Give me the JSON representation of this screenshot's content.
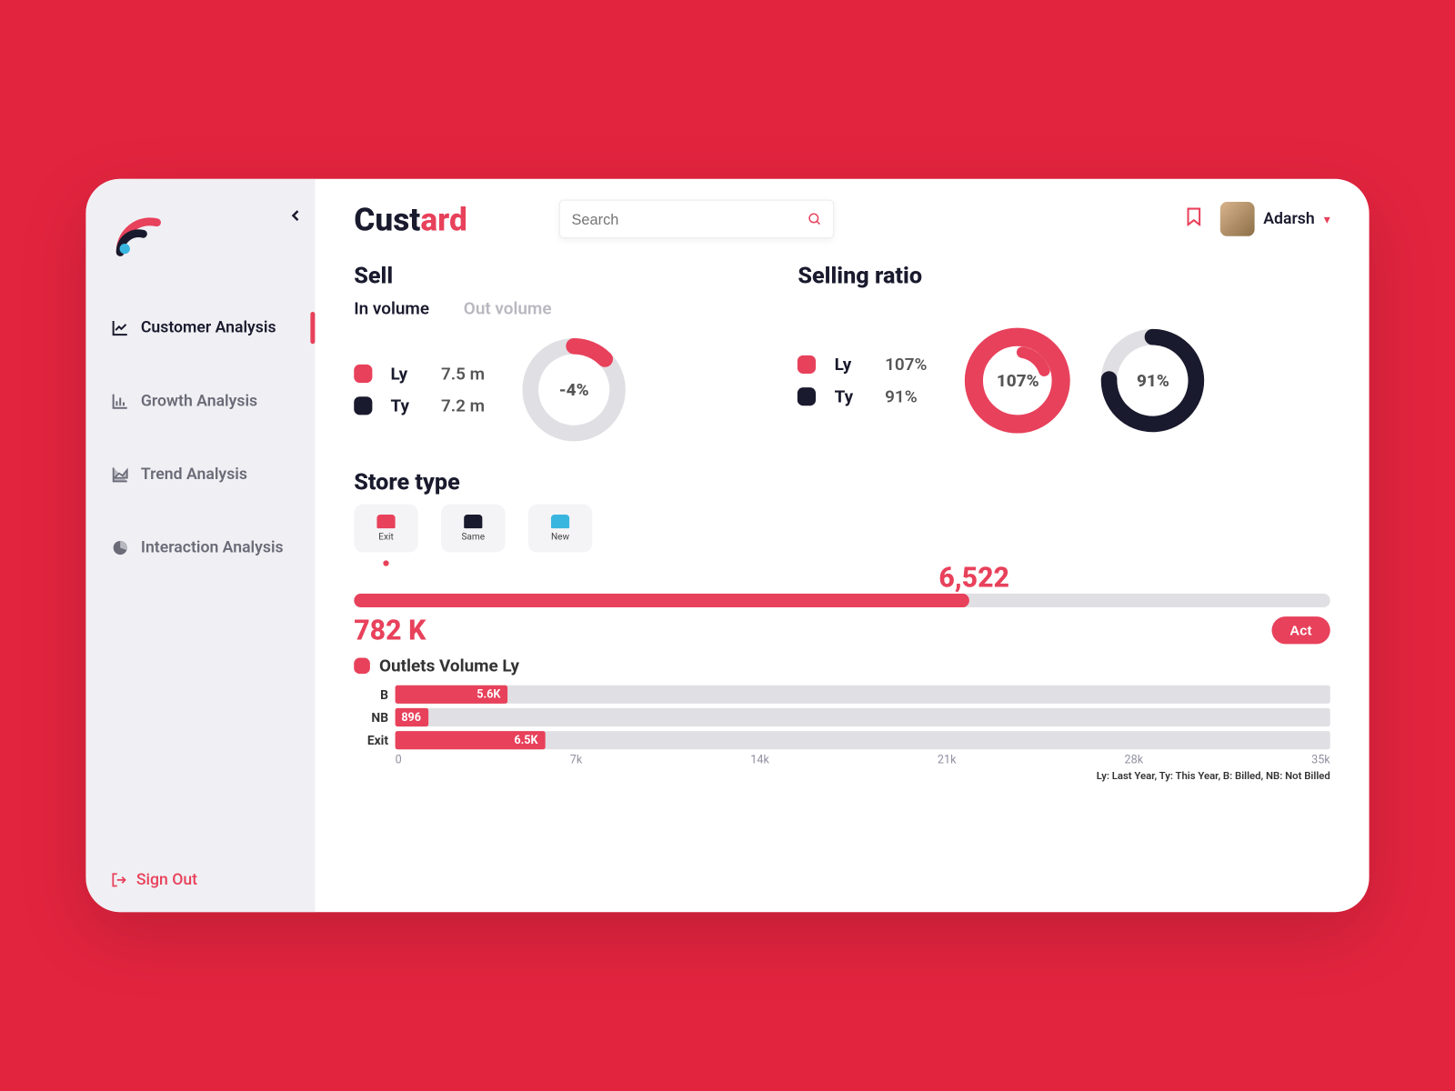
{
  "brand": {
    "first": "Cust",
    "accent": "ard"
  },
  "search": {
    "placeholder": "Search"
  },
  "user": {
    "name": "Adarsh"
  },
  "sidebar": {
    "items": [
      {
        "label": "Customer Analysis",
        "active": true
      },
      {
        "label": "Growth Analysis",
        "active": false
      },
      {
        "label": "Trend  Analysis",
        "active": false
      },
      {
        "label": "Interaction Analysis",
        "active": false
      }
    ],
    "signout": "Sign Out"
  },
  "sell": {
    "title": "Sell",
    "tabs": [
      {
        "label": "In volume",
        "active": true
      },
      {
        "label": "Out volume",
        "active": false
      }
    ],
    "rows": [
      {
        "label": "Ly",
        "value": "7.5 m",
        "color": "red"
      },
      {
        "label": "Ty",
        "value": "7.2 m",
        "color": "navy"
      }
    ],
    "delta": "-4%"
  },
  "ratio": {
    "title": "Selling ratio",
    "rows": [
      {
        "label": "Ly",
        "value": "107%",
        "color": "red"
      },
      {
        "label": "Ty",
        "value": "91%",
        "color": "navy"
      }
    ],
    "d1": {
      "value": "107%",
      "pct": 80,
      "color": "#e8415b"
    },
    "d2": {
      "value": "91%",
      "pct": 75,
      "color": "#1a1a2e"
    }
  },
  "store": {
    "title": "Store type",
    "types": [
      {
        "label": "Exit",
        "color": "red",
        "active": true
      },
      {
        "label": "Same",
        "color": "navy",
        "active": false
      },
      {
        "label": "New",
        "color": "blue",
        "active": false
      }
    ],
    "top_value": "6,522",
    "progress_pct": 63,
    "bottom_value": "782 K",
    "act": "Act"
  },
  "outlets": {
    "title": "Outlets Volume Ly",
    "bars": [
      {
        "label": "B",
        "value": "5.6K",
        "pct": 12
      },
      {
        "label": "NB",
        "value": "896",
        "pct": 3.5
      },
      {
        "label": "Exit",
        "value": "6.5K",
        "pct": 16
      }
    ],
    "axis": [
      "0",
      "7k",
      "14k",
      "21k",
      "28k",
      "35k"
    ]
  },
  "footnote": "Ly: Last Year, Ty: This Year, B: Billed, NB: Not Billed",
  "chart_data": [
    {
      "type": "bar",
      "title": "Outlets Volume Ly",
      "categories": [
        "B",
        "NB",
        "Exit"
      ],
      "values": [
        5600,
        896,
        6500
      ],
      "xlim": [
        0,
        35000
      ],
      "xticks": [
        0,
        7000,
        14000,
        21000,
        28000,
        35000
      ]
    },
    {
      "type": "pie",
      "title": "Sell In volume change",
      "series": [
        {
          "name": "delta",
          "values": [
            -4
          ]
        }
      ]
    },
    {
      "type": "pie",
      "title": "Selling ratio",
      "series": [
        {
          "name": "Ly",
          "values": [
            107
          ]
        },
        {
          "name": "Ty",
          "values": [
            91
          ]
        }
      ]
    }
  ]
}
